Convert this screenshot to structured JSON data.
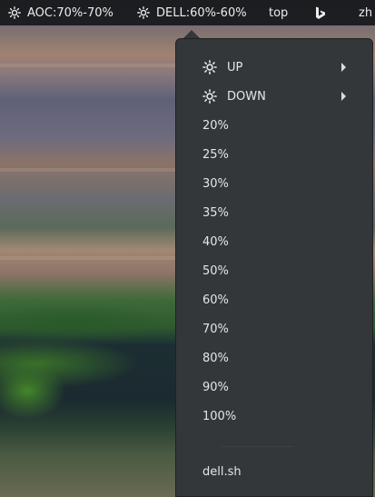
{
  "top_panel": {
    "aoc_label": "AOC:70%-70%",
    "dell_label": "DELL:60%-60%",
    "top_label": "top",
    "bing_icon": "bing-icon",
    "zh_label": "zh"
  },
  "menu": {
    "up_label": "UP",
    "down_label": "DOWN",
    "levels": [
      "20%",
      "25%",
      "30%",
      "35%",
      "40%",
      "50%",
      "60%",
      "70%",
      "80%",
      "90%",
      "100%"
    ],
    "script_label": "dell.sh"
  },
  "colors": {
    "panel_bg": "#16181a",
    "menu_bg": "#333739",
    "text": "#e6e6e6"
  }
}
